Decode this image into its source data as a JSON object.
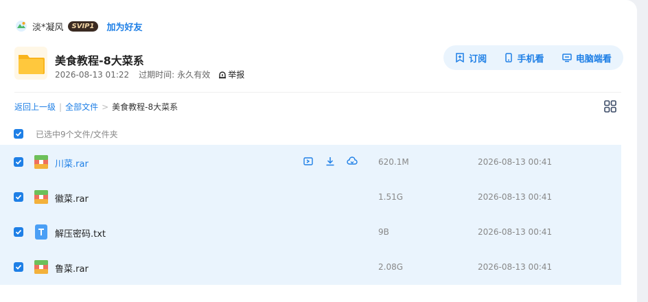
{
  "user": {
    "name": "淡*凝风",
    "vip_badge": "SVIP1",
    "add_friend": "加为好友"
  },
  "share": {
    "title": "美食教程-8大菜系",
    "date": "2026-08-13 01:22",
    "expire_label": "过期时间:",
    "expire_value": "永久有效",
    "report": "举报"
  },
  "actions": {
    "subscribe": "订阅",
    "mobile": "手机看",
    "desktop": "电脑端看"
  },
  "breadcrumb": {
    "back": "返回上一级",
    "sep1": "|",
    "all_files": "全部文件",
    "sep2": ">",
    "current": "美食教程-8大菜系"
  },
  "selection": {
    "text": "已选中9个文件/文件夹"
  },
  "files": [
    {
      "name": "川菜.rar",
      "size": "620.1M",
      "date": "2026-08-13 00:41",
      "type": "archive"
    },
    {
      "name": "徽菜.rar",
      "size": "1.51G",
      "date": "2026-08-13 00:41",
      "type": "archive"
    },
    {
      "name": "解压密码.txt",
      "size": "9B",
      "date": "2026-08-13 00:41",
      "type": "text"
    },
    {
      "name": "鲁菜.rar",
      "size": "2.08G",
      "date": "2026-08-13 00:41",
      "type": "archive"
    }
  ],
  "colors": {
    "accent": "#1e7fe6",
    "row_selected": "#eaf4fd",
    "folder": "#f9b41c"
  }
}
